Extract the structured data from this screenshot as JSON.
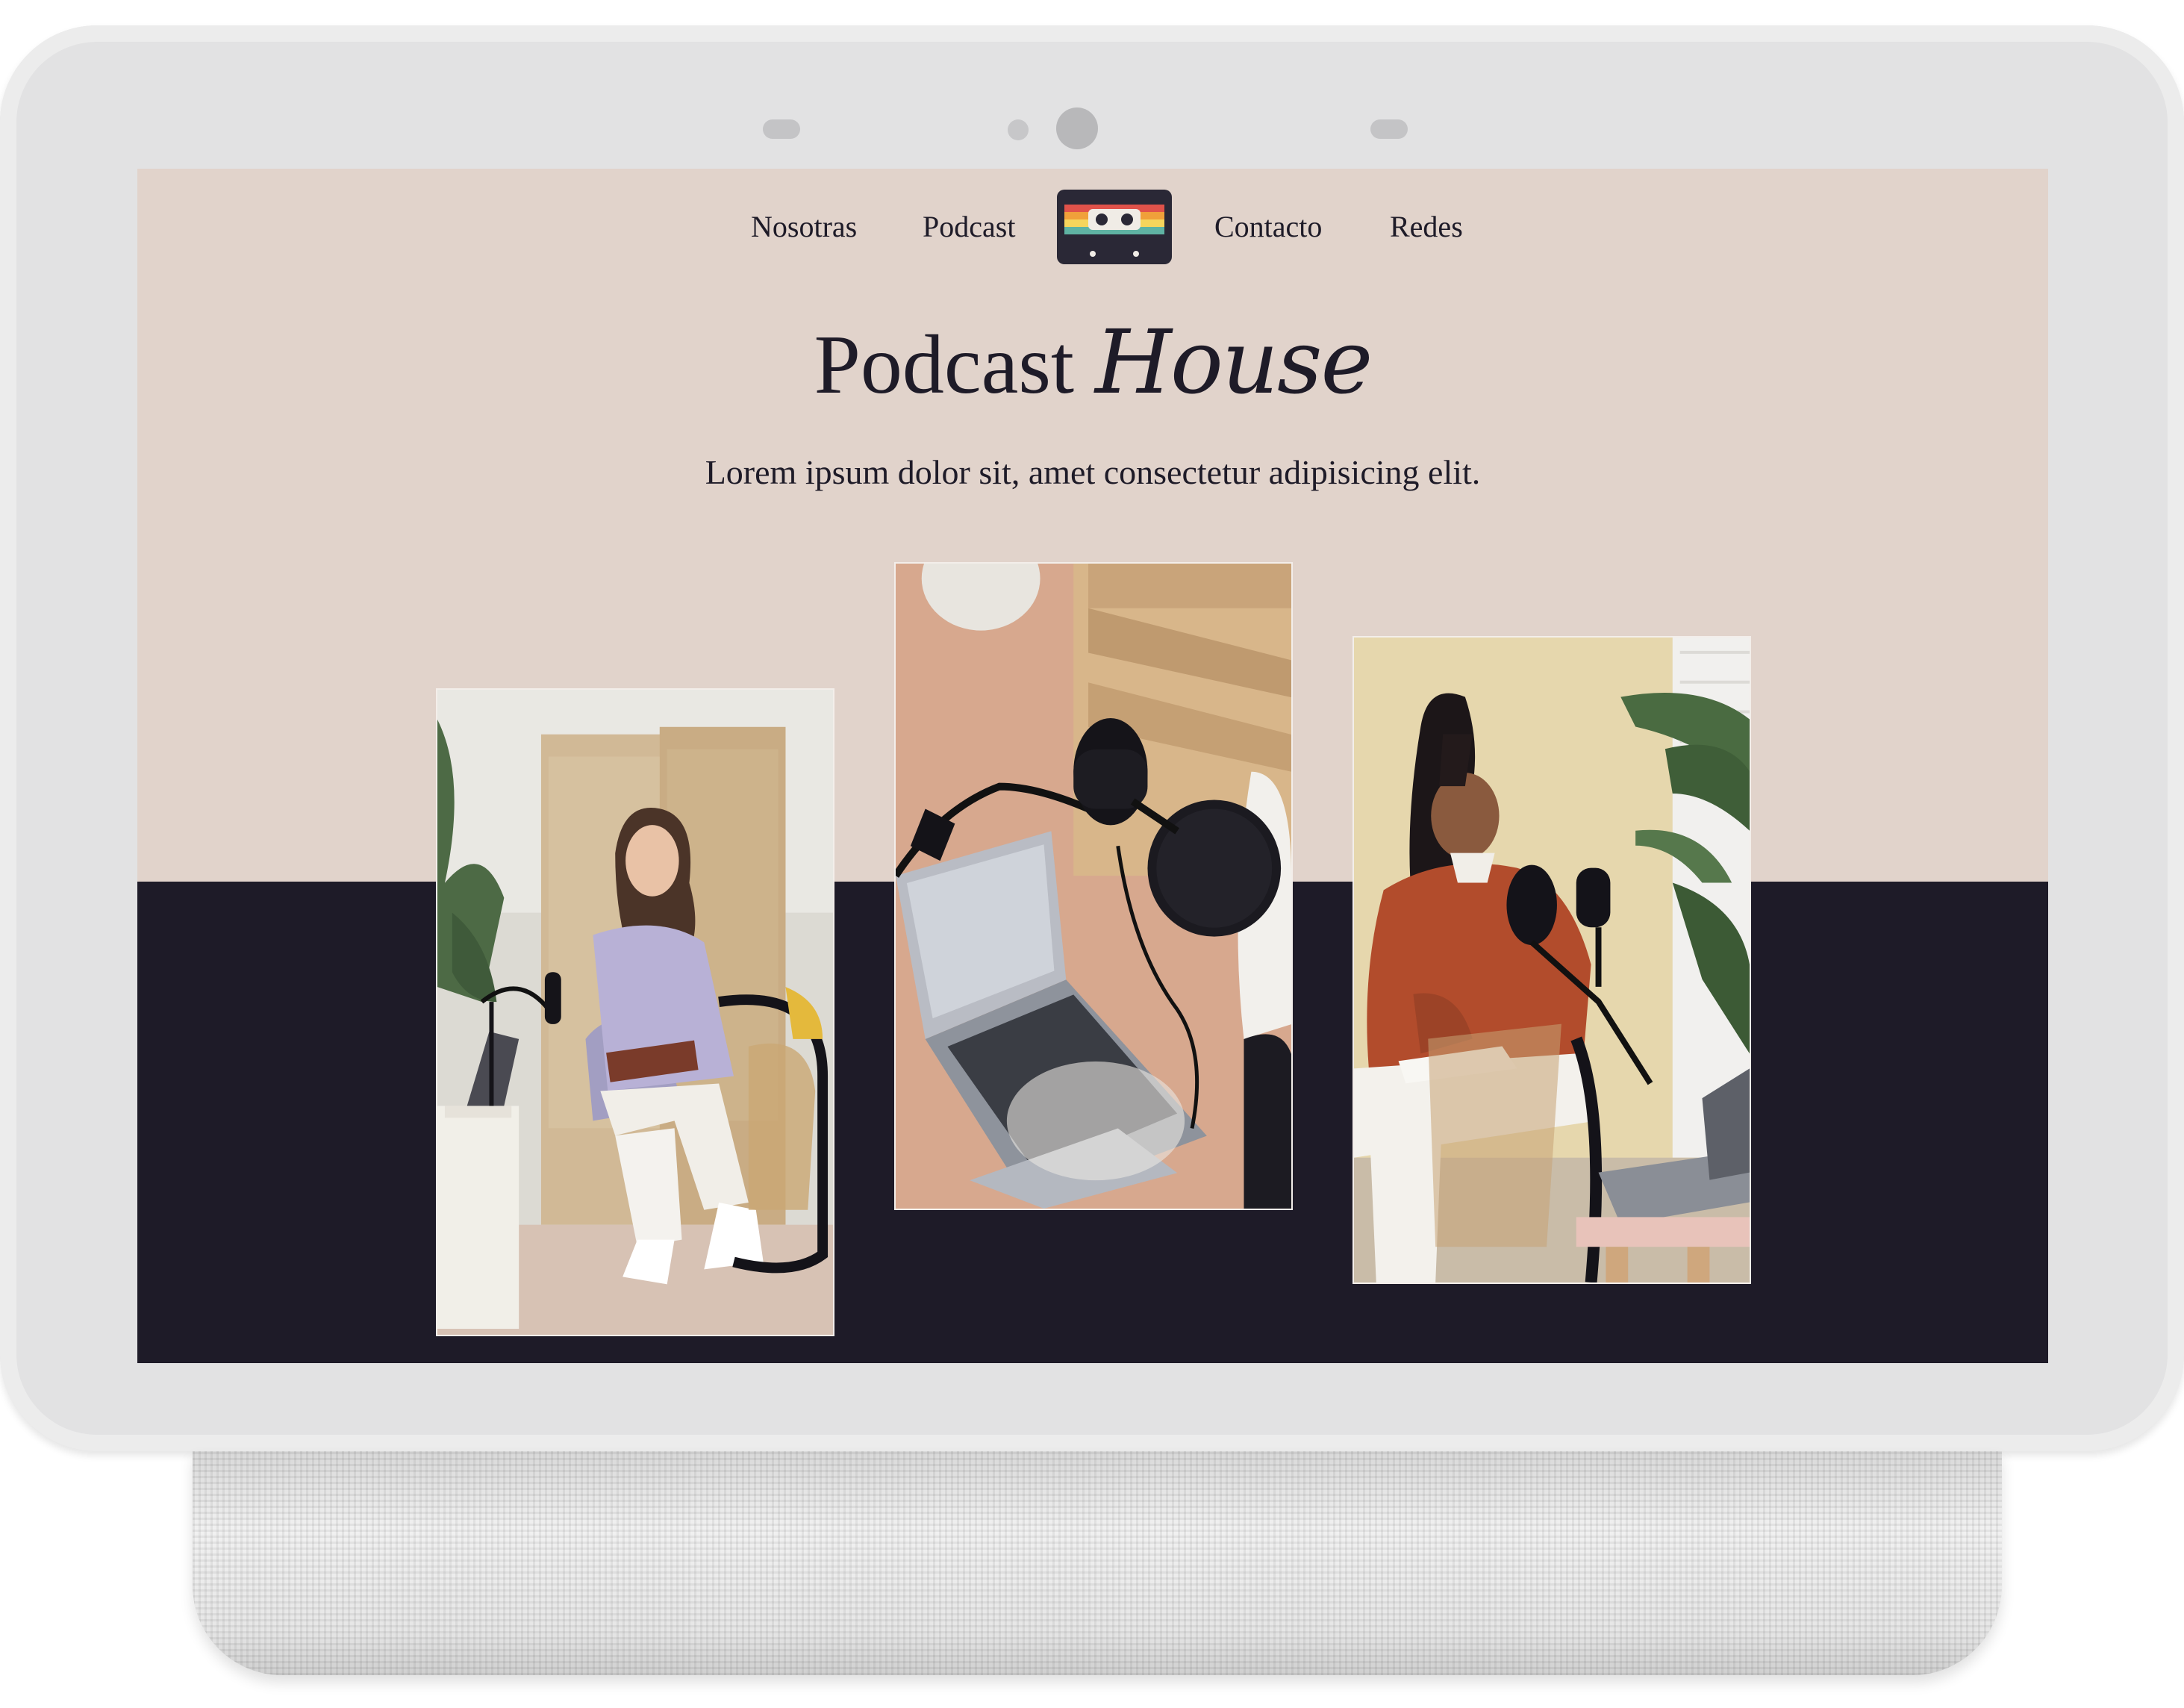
{
  "nav": {
    "left": [
      "Nosotras",
      "Podcast"
    ],
    "right": [
      "Contacto",
      "Redes"
    ],
    "logo_icon": "cassette-tape-icon"
  },
  "hero": {
    "title_main": "Podcast",
    "title_script": "House",
    "subtitle": "Lorem ipsum dolor sit, amet consectetur adipisicing elit."
  },
  "photos": [
    "woman-with-microphone-photo",
    "microphone-and-laptop-photo",
    "woman-speaking-into-microphone-photo"
  ],
  "colors": {
    "hero_bg": "#e1d3cb",
    "dark_bg": "#1e1b28",
    "text": "#1e1b28",
    "logo_stripes": [
      "#e0524a",
      "#f0a03a",
      "#f6d55c",
      "#5fb3a3"
    ]
  }
}
